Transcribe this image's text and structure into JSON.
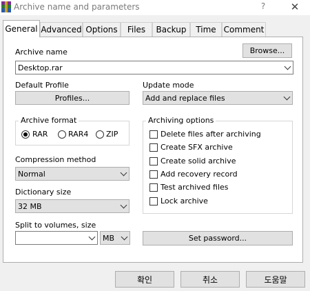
{
  "window": {
    "title": "Archive name and parameters",
    "help": "?",
    "close": "✕"
  },
  "tabs": [
    "General",
    "Advanced",
    "Options",
    "Files",
    "Backup",
    "Time",
    "Comment"
  ],
  "archive_name": {
    "label": "Archive name",
    "value": "Desktop.rar",
    "browse": "Browse..."
  },
  "default_profile": {
    "label": "Default Profile",
    "button": "Profiles..."
  },
  "update_mode": {
    "label": "Update mode",
    "value": "Add and replace files"
  },
  "archive_format": {
    "label": "Archive format",
    "options": [
      "RAR",
      "RAR4",
      "ZIP"
    ],
    "selected": "RAR"
  },
  "compression": {
    "label": "Compression method",
    "value": "Normal"
  },
  "dictionary": {
    "label": "Dictionary size",
    "value": "32 MB"
  },
  "split": {
    "label": "Split to volumes, size",
    "value": "",
    "unit": "MB"
  },
  "archiving_options": {
    "label": "Archiving options",
    "items": [
      "Delete files after archiving",
      "Create SFX archive",
      "Create solid archive",
      "Add recovery record",
      "Test archived files",
      "Lock archive"
    ]
  },
  "set_password": "Set password...",
  "footer": {
    "ok": "확인",
    "cancel": "취소",
    "help": "도움말"
  },
  "colors": {
    "titlebar_text": "#7a7a7a",
    "panel_bg": "#ffffff",
    "dialog_bg": "#f0f0f0"
  }
}
